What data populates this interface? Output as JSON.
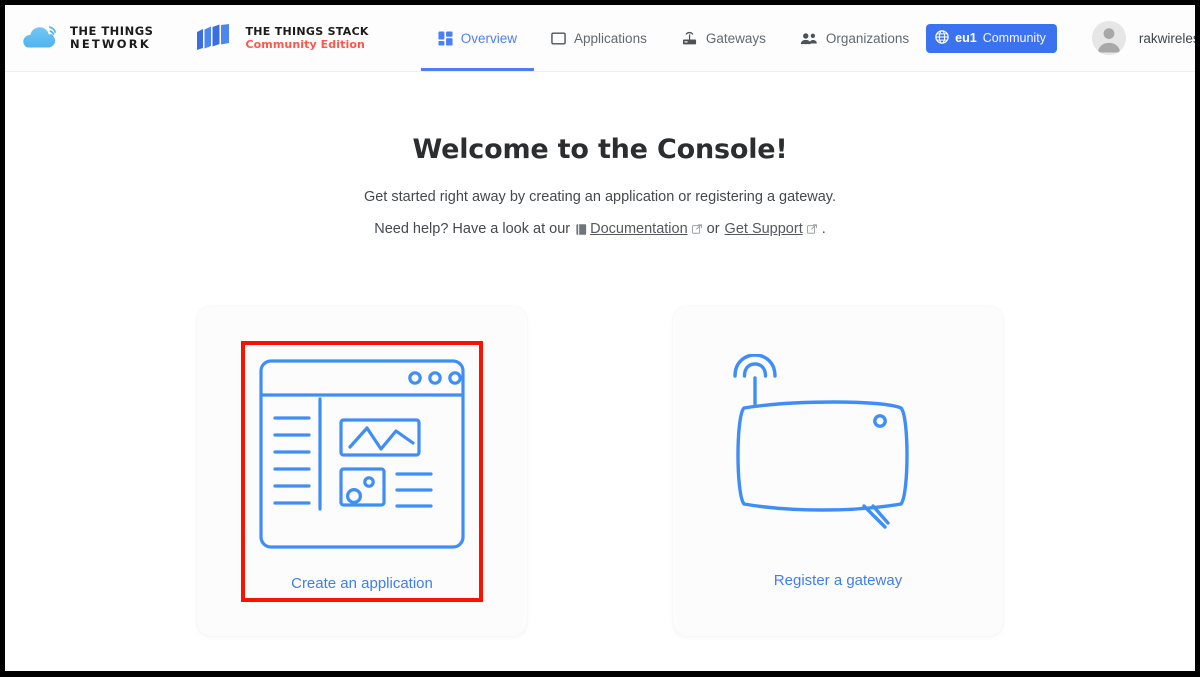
{
  "brand": {
    "ttn_line1": "THE THINGS",
    "ttn_line2": "NETWORK",
    "tts_line1": "THE THINGS STACK",
    "tts_line2": "Community Edition",
    "cloud_icon": "cloud-icon",
    "stack_icon": "stack-layers-icon",
    "accent_blue": "#3b72f0",
    "accent_red": "#ff564a"
  },
  "nav": {
    "items": [
      {
        "label": "Overview",
        "icon": "grid-icon",
        "active": true
      },
      {
        "label": "Applications",
        "icon": "square-outline-icon",
        "active": false
      },
      {
        "label": "Gateways",
        "icon": "gateway-antenna-icon",
        "active": false
      },
      {
        "label": "Organizations",
        "icon": "people-icon",
        "active": false
      }
    ]
  },
  "header_right": {
    "cluster_icon": "globe-icon",
    "cluster_id": "eu1",
    "cluster_tier": "Community",
    "avatar_icon": "user-avatar",
    "username": "rakwireless-app",
    "caret_icon": "chevron-down-icon"
  },
  "main": {
    "title": "Welcome to the Console!",
    "subtitle": "Get started right away by creating an application or registering a gateway.",
    "help_prefix": "Need help? Have a look at our",
    "doc_icon": "book-icon",
    "doc_link": "Documentation",
    "doc_ext_icon": "external-link-icon",
    "help_middle": "or",
    "support_link": "Get Support",
    "support_ext_icon": "external-link-icon",
    "help_suffix": "."
  },
  "cards": [
    {
      "name": "create-application",
      "label": "Create an application",
      "art_icon": "application-dashboard-illustration",
      "highlighted": true,
      "highlight_color": "#fb1100"
    },
    {
      "name": "register-gateway",
      "label": "Register a gateway",
      "art_icon": "gateway-device-illustration",
      "highlighted": false,
      "highlight_color": ""
    }
  ]
}
